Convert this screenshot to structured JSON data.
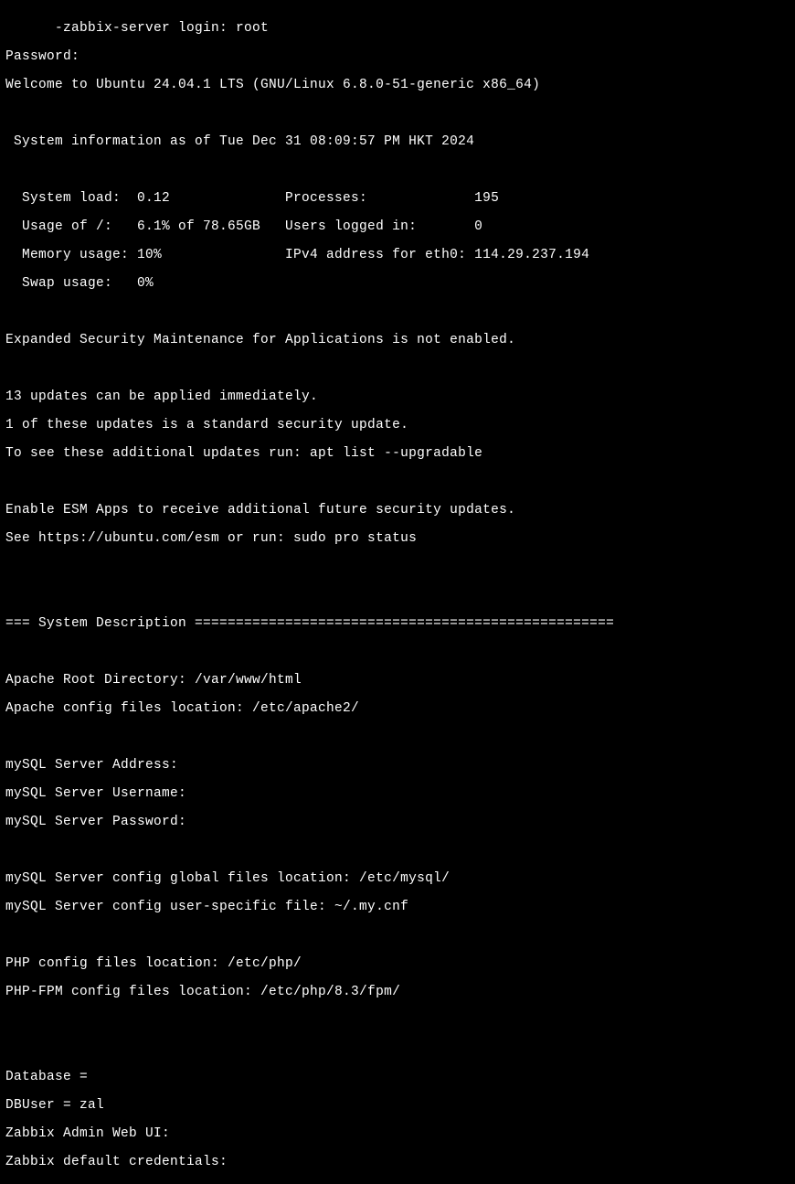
{
  "login_line": "      -zabbix-server login: root",
  "password_line": "Password:",
  "welcome_line": "Welcome to Ubuntu 24.04.1 LTS (GNU/Linux 6.8.0-51-generic x86_64)",
  "sysinfo_header": " System information as of Tue Dec 31 08:09:57 PM HKT 2024",
  "stats_row1": "  System load:  0.12              Processes:             195",
  "stats_row2": "  Usage of /:   6.1% of 78.65GB   Users logged in:       0",
  "stats_row3": "  Memory usage: 10%               IPv4 address for eth0: 114.29.237.194",
  "stats_row4": "  Swap usage:   0%",
  "esm_line": "Expanded Security Maintenance for Applications is not enabled.",
  "updates_line1": "13 updates can be applied immediately.",
  "updates_line2": "1 of these updates is a standard security update.",
  "updates_line3": "To see these additional updates run: apt list --upgradable",
  "esm_enable_line1": "Enable ESM Apps to receive additional future security updates.",
  "esm_enable_line2": "See https://ubuntu.com/esm or run: sudo pro status",
  "sysdesc_header": "=== System Description ===================================================",
  "apache_root": "Apache Root Directory: /var/www/html",
  "apache_config": "Apache config files location: /etc/apache2/",
  "mysql_addr": "mySQL Server Address: ",
  "mysql_user": "mySQL Server Username:",
  "mysql_pass": "mySQL Server Password:",
  "mysql_global": "mySQL Server config global files location: /etc/mysql/",
  "mysql_userspec": "mySQL Server config user-specific file: ~/.my.cnf",
  "php_config": "PHP config files location: /etc/php/",
  "php_fpm_config": "PHP-FPM config files location: /etc/php/8.3/fpm/",
  "database_line": "Database =      ",
  "dbuser_line": "DBUser = zal",
  "zabbix_webui": "Zabbix Admin Web UI:                                         ",
  "zabbix_creds": "Zabbix default credentials: "
}
